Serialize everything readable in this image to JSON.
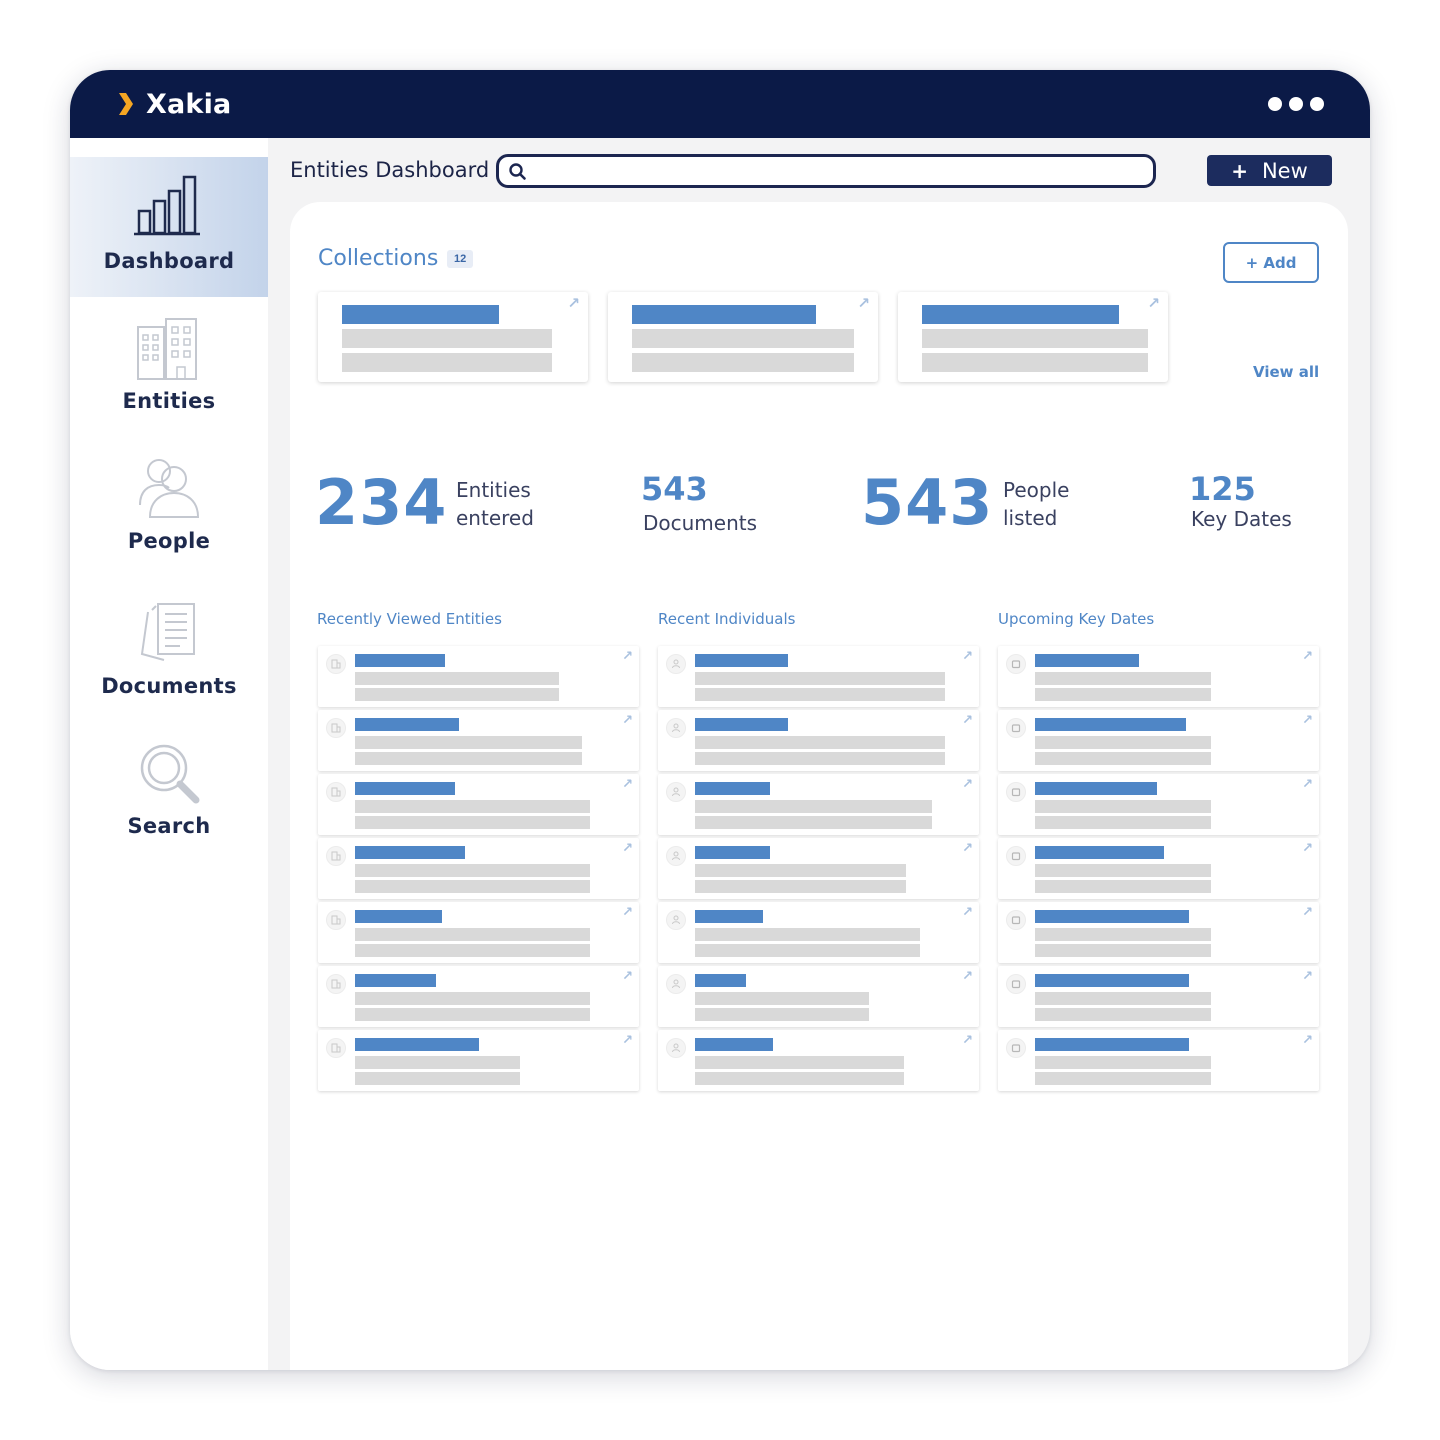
{
  "app": {
    "brand": "Xakia",
    "brand_color": "#f5a623",
    "topbar_color": "#0b1a47",
    "accent_color": "#4f86c6"
  },
  "sidebar": {
    "items": [
      {
        "label": "Dashboard",
        "icon": "bar-chart-icon",
        "active": true
      },
      {
        "label": "Entities",
        "icon": "buildings-icon",
        "active": false
      },
      {
        "label": "People",
        "icon": "people-icon",
        "active": false
      },
      {
        "label": "Documents",
        "icon": "documents-icon",
        "active": false
      },
      {
        "label": "Search",
        "icon": "search-icon",
        "active": false
      }
    ]
  },
  "header": {
    "title": "Entities Dashboard",
    "search_placeholder": "",
    "new_button": {
      "plus": "+",
      "label": "New"
    }
  },
  "collections": {
    "title": "Collections",
    "count": "12",
    "add_button": "+ Add",
    "view_all": "View all"
  },
  "stats": [
    {
      "value": "234",
      "label_line1": "Entities",
      "label_line2": "entered"
    },
    {
      "value": "543",
      "label_line1": "Documents",
      "label_line2": ""
    },
    {
      "value": "543",
      "label_line1": "People",
      "label_line2": "listed"
    },
    {
      "value": "125",
      "label_line1": "Key Dates",
      "label_line2": ""
    }
  ],
  "lists": [
    {
      "title": "Recently Viewed Entities",
      "row_icon": "building-icon",
      "rows": 7
    },
    {
      "title": "Recent Individuals",
      "row_icon": "person-icon",
      "rows": 7
    },
    {
      "title": "Upcoming Key Dates",
      "row_icon": "calendar-icon",
      "rows": 7
    }
  ]
}
